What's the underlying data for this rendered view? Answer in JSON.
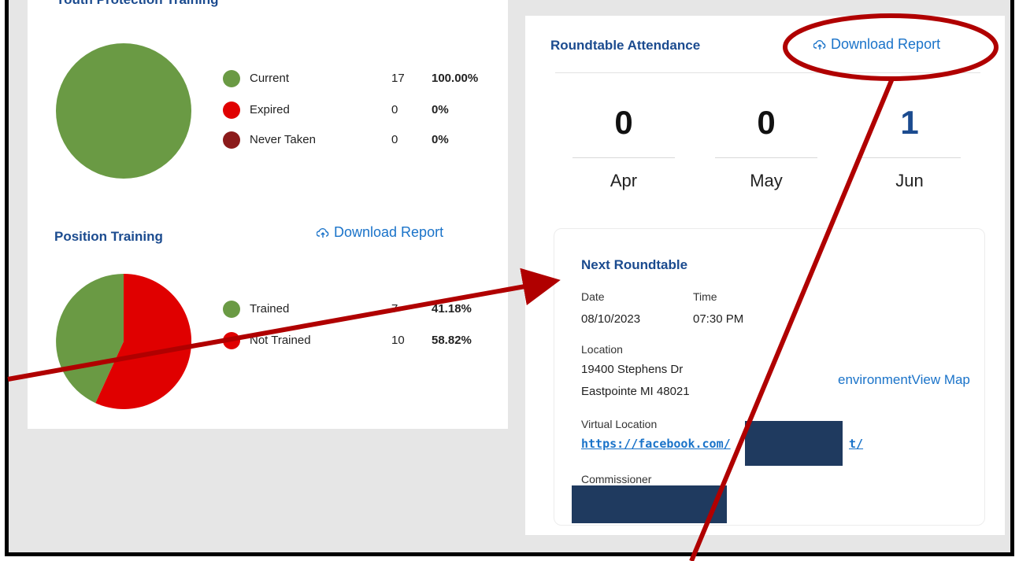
{
  "youth_protection": {
    "title": "Youth Protection Training",
    "legend": [
      {
        "label": "Current",
        "count": "17",
        "percent": "100.00%",
        "color": "#6a9a44"
      },
      {
        "label": "Expired",
        "count": "0",
        "percent": "0%",
        "color": "#e00000"
      },
      {
        "label": "Never Taken",
        "count": "0",
        "percent": "0%",
        "color": "#8b1a1a"
      }
    ]
  },
  "position_training": {
    "title": "Position Training",
    "download_label": "Download Report",
    "legend": [
      {
        "label": "Trained",
        "count": "7",
        "percent": "41.18%",
        "color": "#6a9a44"
      },
      {
        "label": "Not Trained",
        "count": "10",
        "percent": "58.82%",
        "color": "#e00000"
      }
    ]
  },
  "roundtable": {
    "title": "Roundtable Attendance",
    "download_label": "Download Report",
    "stats": [
      {
        "value": "0",
        "month": "Apr"
      },
      {
        "value": "0",
        "month": "May"
      },
      {
        "value": "1",
        "month": "Jun"
      }
    ]
  },
  "next_roundtable": {
    "title": "Next Roundtable",
    "date_label": "Date",
    "date_value": "08/10/2023",
    "time_label": "Time",
    "time_value": "07:30 PM",
    "location_label": "Location",
    "address_line1": "19400 Stephens Dr",
    "address_line2": "Eastpointe MI 48021",
    "map_link": "environmentView Map",
    "virtual_label": "Virtual Location",
    "virtual_url": "https://facebook.com/",
    "virtual_url_tail": "t/",
    "commissioner_label": "Commissioner"
  },
  "colors": {
    "accent": "#1b4b8f",
    "link": "#1a73c9",
    "annotation": "#b00000"
  }
}
